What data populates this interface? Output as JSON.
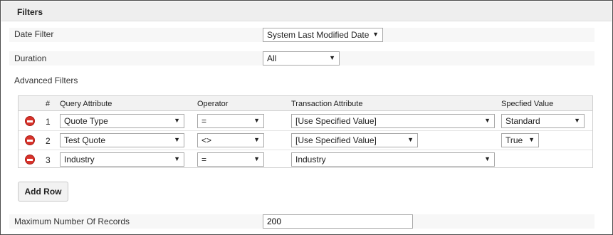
{
  "section": {
    "title": "Filters"
  },
  "date_filter": {
    "label": "Date Filter",
    "value": "System Last Modified Date"
  },
  "duration": {
    "label": "Duration",
    "value": "All"
  },
  "advanced": {
    "label": "Advanced Filters",
    "columns": {
      "num": "#",
      "query": "Query Attribute",
      "operator": "Operator",
      "transaction": "Transaction Attribute",
      "specified": "Specfied Value"
    },
    "rows": [
      {
        "num": "1",
        "query": "Quote Type",
        "operator": "=",
        "transaction": "[Use Specified Value]",
        "specified": "Standard"
      },
      {
        "num": "2",
        "query": "Test Quote",
        "operator": "<>",
        "transaction": "[Use Specified Value]",
        "specified": "True"
      },
      {
        "num": "3",
        "query": "Industry",
        "operator": "=",
        "transaction": "Industry",
        "specified": ""
      }
    ]
  },
  "add_row": {
    "label": "Add Row"
  },
  "max_records": {
    "label": "Maximum Number Of Records",
    "value": "200"
  },
  "colors": {
    "delete": "#d9322a",
    "header_bg": "#eeeeee",
    "band_bg": "#f7f7f7"
  }
}
